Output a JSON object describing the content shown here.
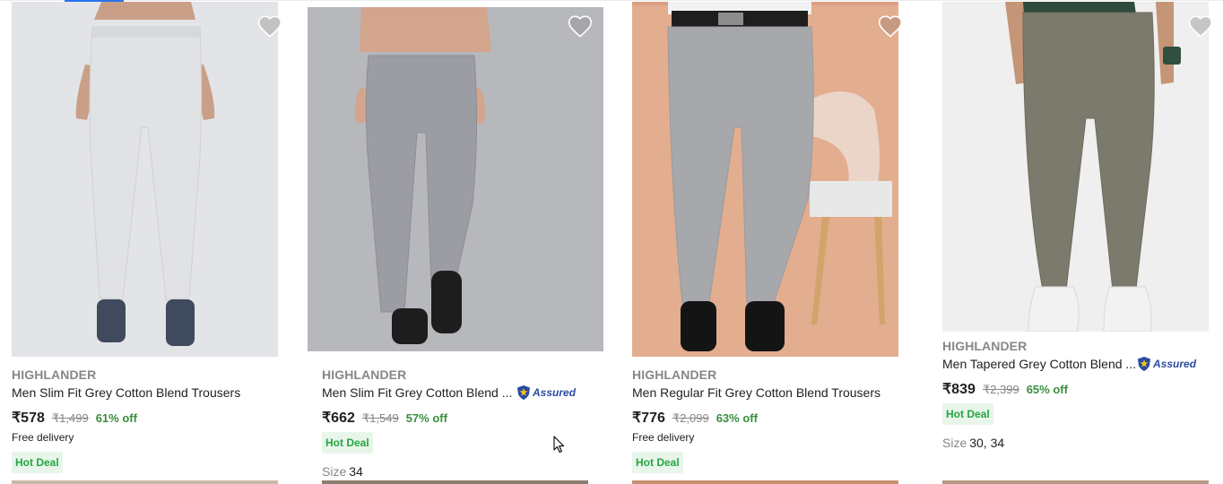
{
  "products": [
    {
      "brand": "HIGHLANDER",
      "title": "Men Slim Fit Grey Cotton Blend Trousers",
      "price": "₹578",
      "mrp": "₹1,499",
      "discount": "61% off",
      "delivery": "Free delivery",
      "deal": "Hot Deal",
      "wishlist_icon": "heart-icon",
      "colors": {
        "bg": "#e3e4e8",
        "pant": "#e1e2e4",
        "shoe": "#3f4a5e"
      }
    },
    {
      "brand": "HIGHLANDER",
      "title": "Men Slim Fit Grey Cotton Blend ...",
      "assured": "Assured",
      "price": "₹662",
      "mrp": "₹1,549",
      "discount": "57% off",
      "deal": "Hot Deal",
      "size_label": "Size",
      "size_value": "34",
      "wishlist_icon": "heart-icon",
      "colors": {
        "bg": "#b7b8bc",
        "pant": "#9c9ca4",
        "shoe": "#1d1d1d"
      }
    },
    {
      "brand": "HIGHLANDER",
      "title": "Men Regular Fit Grey Cotton Blend Trousers",
      "price": "₹776",
      "mrp": "₹2,099",
      "discount": "63% off",
      "delivery": "Free delivery",
      "deal": "Hot Deal",
      "wishlist_icon": "heart-icon",
      "colors": {
        "bg": "#e3ad8f",
        "pant": "#a7a8ac",
        "shoe": "#141414"
      }
    },
    {
      "brand": "HIGHLANDER",
      "title": "Men Tapered Grey Cotton Blend ...",
      "assured": "Assured",
      "price": "₹839",
      "mrp": "₹2,399",
      "discount": "65% off",
      "deal": "Hot Deal",
      "size_label": "Size",
      "size_value": "30, 34",
      "wishlist_icon": "heart-icon",
      "colors": {
        "bg": "#efefef",
        "pant": "#7c7a6c",
        "shoe": "#f2f2f2"
      }
    }
  ]
}
